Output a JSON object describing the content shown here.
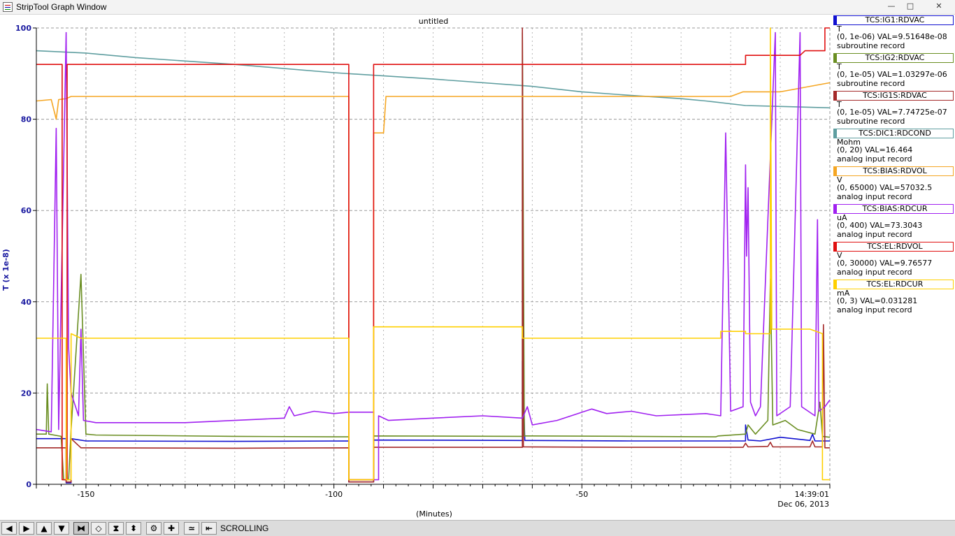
{
  "window": {
    "title": "StripTool Graph Window",
    "controls": {
      "minimize": "—",
      "maximize": "□",
      "close": "✕"
    }
  },
  "plot": {
    "title": "untitled",
    "y_label": "T (x 1e-8)",
    "x_label": "(Minutes)",
    "timestamp_time": "14:39:01",
    "timestamp_date": "Dec 06, 2013",
    "y_ticks": [
      "100",
      "80",
      "60",
      "40",
      "20",
      "0"
    ],
    "x_ticks": [
      "-150",
      "-100",
      "-50"
    ],
    "background": "#ffffff",
    "grid_color": "#9a9a9a"
  },
  "legend": [
    {
      "name": "TCS:IG1:RDVAC",
      "color": "#1010d0",
      "unit": "T",
      "range": "(0, 1e-06) VAL=9.51648e-08",
      "type": "subroutine record"
    },
    {
      "name": "TCS:IG2:RDVAC",
      "color": "#6a8e22",
      "unit": "T",
      "range": "(0, 1e-05) VAL=1.03297e-06",
      "type": "subroutine record"
    },
    {
      "name": "TCS:IG1S:RDVAC",
      "color": "#a52a2a",
      "unit": "T",
      "range": "(0, 1e-05) VAL=7.74725e-07",
      "type": "subroutine record"
    },
    {
      "name": "TCS:DIC1:RDCOND",
      "color": "#5f9ea0",
      "unit": "Mohm",
      "range": "(0, 20) VAL=16.464",
      "type": "analog input record"
    },
    {
      "name": "TCS:BIAS:RDVOL",
      "color": "#f5a623",
      "unit": "V",
      "range": "(0, 65000) VAL=57032.5",
      "type": "analog input record"
    },
    {
      "name": "TCS:BIAS:RDCUR",
      "color": "#a020f0",
      "unit": "uA",
      "range": "(0, 400) VAL=73.3043",
      "type": "analog input record"
    },
    {
      "name": "TCS:EL:RDVOL",
      "color": "#e01010",
      "unit": "V",
      "range": "(0, 30000) VAL=9.76577",
      "type": "analog input record"
    },
    {
      "name": "TCS:EL:RDCUR",
      "color": "#ffd000",
      "unit": "mA",
      "range": "(0, 3) VAL=0.031281",
      "type": "analog input record"
    }
  ],
  "toolbar": {
    "mode": "SCROLLING",
    "buttons": [
      {
        "icon": "arrow-left-icon",
        "glyph": "◀"
      },
      {
        "icon": "arrow-right-icon",
        "glyph": "▶"
      },
      {
        "icon": "arrow-up-icon",
        "glyph": "▲"
      },
      {
        "icon": "arrow-down-icon",
        "glyph": "▼"
      },
      {
        "icon": "zoom-in-x-icon",
        "glyph": "⧓"
      },
      {
        "icon": "zoom-out-x-icon",
        "glyph": "◇"
      },
      {
        "icon": "zoom-in-y-icon",
        "glyph": "⧗"
      },
      {
        "icon": "zoom-out-y-icon",
        "glyph": "⬍"
      },
      {
        "icon": "config-icon",
        "glyph": "⚙"
      },
      {
        "icon": "add-icon",
        "glyph": "✚"
      },
      {
        "icon": "auto-scale-icon",
        "glyph": "≃"
      },
      {
        "icon": "scroll-mode-icon",
        "glyph": "⇤"
      }
    ]
  },
  "chart_data": {
    "type": "line",
    "xlabel": "(Minutes)",
    "ylabel": "T (x 1e-8)",
    "xlim": [
      -160,
      0
    ],
    "ylim": [
      0,
      100
    ],
    "x_ticks": [
      -150,
      -100,
      -50
    ],
    "y_ticks": [
      0,
      20,
      40,
      60,
      80,
      100
    ],
    "grid": true,
    "series": [
      {
        "name": "TCS:DIC1:RDCOND",
        "color": "#5f9ea0",
        "points": [
          [
            -160,
            95
          ],
          [
            -150,
            94.5
          ],
          [
            -140,
            93.5
          ],
          [
            -120,
            92
          ],
          [
            -100,
            90.2
          ],
          [
            -80,
            88.8
          ],
          [
            -60,
            87.2
          ],
          [
            -50,
            86
          ],
          [
            -40,
            85.2
          ],
          [
            -30,
            84.5
          ],
          [
            -25,
            84
          ],
          [
            -17,
            83
          ],
          [
            -10,
            82.8
          ],
          [
            0,
            82.5
          ]
        ]
      },
      {
        "name": "TCS:IG1:RDVAC",
        "color": "#1010d0",
        "points": [
          [
            -160,
            10
          ],
          [
            -154,
            10
          ],
          [
            -154,
            0.3
          ],
          [
            -153,
            0.3
          ],
          [
            -153,
            10
          ],
          [
            -150,
            9.5
          ],
          [
            -120,
            9.4
          ],
          [
            -97,
            9.5
          ],
          [
            -97,
            0.5
          ],
          [
            -92,
            0.5
          ],
          [
            -92,
            9.7
          ],
          [
            -62,
            9.6
          ],
          [
            -62,
            27
          ],
          [
            -61.5,
            9.6
          ],
          [
            -40,
            9.5
          ],
          [
            -17,
            9.5
          ],
          [
            -17,
            13
          ],
          [
            -16.5,
            9.7
          ],
          [
            -14,
            9.5
          ],
          [
            -10,
            10.3
          ],
          [
            -4,
            9.6
          ],
          [
            -3.5,
            11
          ],
          [
            -3,
            9.5
          ],
          [
            0,
            9.5
          ]
        ]
      },
      {
        "name": "TCS:IG2:RDVAC",
        "color": "#6a8e22",
        "points": [
          [
            -160,
            11
          ],
          [
            -158,
            11
          ],
          [
            -157.8,
            22
          ],
          [
            -157.5,
            11
          ],
          [
            -155,
            10.5
          ],
          [
            -154.5,
            1
          ],
          [
            -153.5,
            1
          ],
          [
            -153,
            12
          ],
          [
            -151,
            46
          ],
          [
            -150,
            11
          ],
          [
            -148,
            10.8
          ],
          [
            -120,
            10.5
          ],
          [
            -100,
            10.4
          ],
          [
            -97,
            10.4
          ],
          [
            -97,
            1
          ],
          [
            -92,
            1
          ],
          [
            -92,
            10.6
          ],
          [
            -62,
            10.5
          ],
          [
            -62,
            99
          ],
          [
            -61.6,
            10.6
          ],
          [
            -40,
            10.5
          ],
          [
            -23,
            10.4
          ],
          [
            -22.5,
            10.6
          ],
          [
            -17,
            11
          ],
          [
            -16.5,
            13
          ],
          [
            -15,
            11
          ],
          [
            -12.5,
            14
          ],
          [
            -12,
            45
          ],
          [
            -11.5,
            13
          ],
          [
            -9,
            14
          ],
          [
            -6.5,
            12
          ],
          [
            -3,
            11
          ],
          [
            -2,
            18
          ],
          [
            -1.5,
            10.5
          ],
          [
            0,
            10.3
          ]
        ]
      },
      {
        "name": "TCS:IG1S:RDVAC",
        "color": "#a52a2a",
        "points": [
          [
            -160,
            8
          ],
          [
            -154,
            8
          ],
          [
            -154,
            0.5
          ],
          [
            -153,
            0.5
          ],
          [
            -153,
            10
          ],
          [
            -151,
            8
          ],
          [
            -120,
            7.9
          ],
          [
            -97,
            8
          ],
          [
            -97,
            0.5
          ],
          [
            -92,
            0.5
          ],
          [
            -92,
            8.1
          ],
          [
            -62,
            8.1
          ],
          [
            -62,
            100
          ],
          [
            -61.8,
            8.2
          ],
          [
            -40,
            8.1
          ],
          [
            -17.5,
            8.1
          ],
          [
            -17,
            9
          ],
          [
            -16.5,
            8.2
          ],
          [
            -12.5,
            8.3
          ],
          [
            -12,
            9.2
          ],
          [
            -11.5,
            8.2
          ],
          [
            -4,
            8.2
          ],
          [
            -3.5,
            9.5
          ],
          [
            -3,
            8.2
          ],
          [
            -1.5,
            8.2
          ],
          [
            -1.3,
            35
          ],
          [
            -1,
            8
          ],
          [
            0,
            8
          ]
        ]
      },
      {
        "name": "TCS:BIAS:RDVOL",
        "color": "#f5a623",
        "points": [
          [
            -160,
            84
          ],
          [
            -157,
            84.3
          ],
          [
            -156,
            80
          ],
          [
            -155.5,
            84.3
          ],
          [
            -154,
            84.5
          ],
          [
            -153,
            85
          ],
          [
            -144,
            85
          ],
          [
            -120,
            85
          ],
          [
            -97,
            85
          ],
          [
            -97,
            1
          ],
          [
            -92,
            1
          ],
          [
            -92,
            77
          ],
          [
            -90,
            77
          ],
          [
            -89.5,
            85
          ],
          [
            -62,
            85
          ],
          [
            -40,
            85
          ],
          [
            -20,
            85
          ],
          [
            -17.5,
            86
          ],
          [
            -10,
            86
          ],
          [
            -5,
            87
          ],
          [
            0,
            88
          ]
        ]
      },
      {
        "name": "TCS:BIAS:RDCUR",
        "color": "#a020f0",
        "points": [
          [
            -160,
            12
          ],
          [
            -157,
            11.5
          ],
          [
            -156,
            78
          ],
          [
            -155.5,
            12
          ],
          [
            -154,
            99
          ],
          [
            -153.5,
            30
          ],
          [
            -153,
            20
          ],
          [
            -151.5,
            15
          ],
          [
            -151,
            34
          ],
          [
            -150.5,
            14
          ],
          [
            -148,
            13.5
          ],
          [
            -130,
            13.5
          ],
          [
            -120,
            14
          ],
          [
            -110,
            14.5
          ],
          [
            -109,
            17
          ],
          [
            -108,
            15
          ],
          [
            -104,
            16
          ],
          [
            -100,
            15.5
          ],
          [
            -97,
            15.8
          ],
          [
            -97,
            15.8
          ],
          [
            -92,
            15.8
          ],
          [
            -92,
            1
          ],
          [
            -91,
            1
          ],
          [
            -91,
            15
          ],
          [
            -89,
            14
          ],
          [
            -80,
            14.5
          ],
          [
            -70,
            15
          ],
          [
            -62,
            14.5
          ],
          [
            -61,
            17
          ],
          [
            -60,
            13
          ],
          [
            -55,
            14
          ],
          [
            -48,
            16.5
          ],
          [
            -45,
            15.5
          ],
          [
            -40,
            16
          ],
          [
            -35,
            15
          ],
          [
            -25,
            15.5
          ],
          [
            -22,
            15
          ],
          [
            -21,
            77
          ],
          [
            -20,
            16
          ],
          [
            -17.5,
            17
          ],
          [
            -17,
            70
          ],
          [
            -16.8,
            50
          ],
          [
            -16.5,
            65
          ],
          [
            -16,
            18
          ],
          [
            -15,
            15
          ],
          [
            -14,
            17
          ],
          [
            -11,
            99
          ],
          [
            -10.7,
            15
          ],
          [
            -8,
            17
          ],
          [
            -6,
            99
          ],
          [
            -5.7,
            17
          ],
          [
            -3,
            15
          ],
          [
            -2.5,
            58
          ],
          [
            -2.2,
            16
          ],
          [
            -1,
            17
          ],
          [
            0,
            18.5
          ]
        ]
      },
      {
        "name": "TCS:EL:RDVOL",
        "color": "#e01010",
        "points": [
          [
            -160,
            92
          ],
          [
            -154.8,
            92
          ],
          [
            -154.8,
            1
          ],
          [
            -153.8,
            1
          ],
          [
            -153.8,
            92
          ],
          [
            -120,
            92
          ],
          [
            -97,
            92
          ],
          [
            -97,
            1
          ],
          [
            -92,
            1
          ],
          [
            -92,
            92
          ],
          [
            -62,
            92
          ],
          [
            -40,
            92
          ],
          [
            -17,
            92
          ],
          [
            -17,
            94
          ],
          [
            -6,
            94
          ],
          [
            -5,
            95
          ],
          [
            -1,
            95
          ],
          [
            -1,
            100
          ],
          [
            0,
            100
          ]
        ]
      },
      {
        "name": "TCS:EL:RDCUR",
        "color": "#ffd000",
        "points": [
          [
            -160,
            32
          ],
          [
            -154,
            32
          ],
          [
            -154,
            1
          ],
          [
            -153,
            1
          ],
          [
            -153,
            33
          ],
          [
            -151,
            32
          ],
          [
            -97,
            32
          ],
          [
            -97,
            1
          ],
          [
            -92,
            1
          ],
          [
            -92,
            34.5
          ],
          [
            -62,
            34.5
          ],
          [
            -62,
            32
          ],
          [
            -40,
            32
          ],
          [
            -22,
            32
          ],
          [
            -22,
            33.5
          ],
          [
            -17,
            33.5
          ],
          [
            -17,
            33
          ],
          [
            -12,
            33
          ],
          [
            -12,
            100
          ],
          [
            -11.7,
            34
          ],
          [
            -4,
            34
          ],
          [
            -1.5,
            33
          ],
          [
            -1.5,
            1
          ],
          [
            0,
            1
          ]
        ]
      }
    ]
  }
}
